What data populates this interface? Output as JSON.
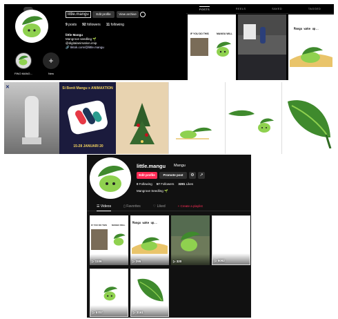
{
  "instagram": {
    "username": "little.mangu",
    "edit_profile": "Edit profile",
    "view_archive": "View archive",
    "stats": [
      {
        "count": "9",
        "label": "posts"
      },
      {
        "count": "92",
        "label": "followers"
      },
      {
        "count": "11",
        "label": "following"
      }
    ],
    "bio_name": "little Mangu",
    "bio_line1": "Mangrove seedling 🌱",
    "bio_line2": "@digitalanimation.imip",
    "bio_link": "🔗 tiktok.com/@little.mangu",
    "highlights": [
      {
        "label": "FINO MANG..."
      },
      {
        "label": "New"
      }
    ],
    "tabs": [
      "POSTS",
      "REELS",
      "SAVED",
      "TAGGED"
    ],
    "post2_text1": "IF YOU DO THIS",
    "post2_text2": "MANGU WILL",
    "post_text_wakeup": "Mangu wake up..",
    "banner_title": "Si Bonit Mangu x ANIMAXTION",
    "banner_date": "15-28 JANUARI 20"
  },
  "tiktok": {
    "handle": "little.mangu",
    "nickname": "Mangu",
    "edit_profile": "Edit profile",
    "promote_post": "Promote post",
    "stats": [
      {
        "count": "0",
        "label": "Following"
      },
      {
        "count": "57",
        "label": "Followers"
      },
      {
        "count": "3281",
        "label": "Likes"
      }
    ],
    "bio": "Mangrove Seedling 🌱",
    "tabs": [
      "Videos",
      "Favorites",
      "Liked"
    ],
    "create_playlist": "+ Create a playlist",
    "video_text1": "IF YOU DO THIS",
    "video_text2": "MANGU WILL",
    "video_text_wakeup": "Mangu wake up..",
    "videos": [
      {
        "views": "1106"
      },
      {
        "views": "295"
      },
      {
        "views": "320"
      },
      {
        "views": "6092"
      },
      {
        "views": "5707"
      },
      {
        "views": "3161"
      }
    ]
  },
  "colors": {
    "leaf_green": "#3f8a2d",
    "leaf_light": "#8fd14f",
    "tiktok_pink": "#fe2c55",
    "panel_black": "#000000"
  }
}
